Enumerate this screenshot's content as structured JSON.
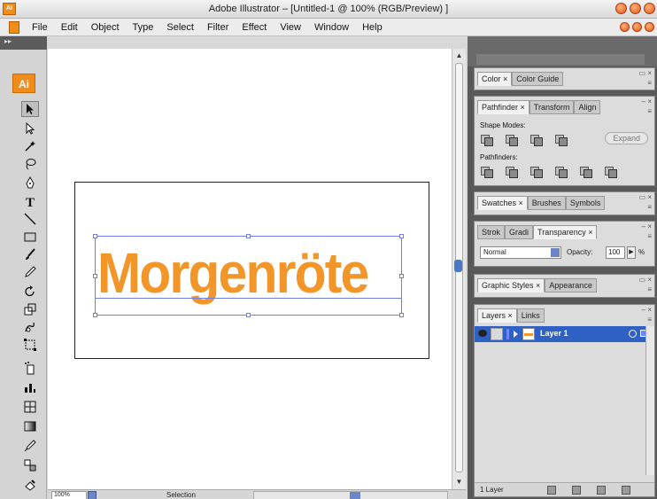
{
  "window": {
    "title": "Adobe Illustrator – [Untitled-1 @ 100% (RGB/Preview) ]",
    "app_icon_text": "AI"
  },
  "menu": {
    "items": [
      "File",
      "Edit",
      "Object",
      "Type",
      "Select",
      "Filter",
      "Effect",
      "View",
      "Window",
      "Help"
    ]
  },
  "toolbar": {
    "logo_text": "Ai",
    "grip_text": "▸▸",
    "tools": [
      "selection-tool",
      "direct-selection-tool",
      "magic-wand-tool",
      "lasso-tool",
      "pen-tool",
      "type-tool",
      "line-segment-tool",
      "rectangle-tool",
      "paintbrush-tool",
      "pencil-tool",
      "rotate-tool",
      "scale-tool",
      "warp-tool",
      "free-transform-tool",
      "symbol-sprayer-tool",
      "column-graph-tool",
      "mesh-tool",
      "gradient-tool",
      "eyedropper-tool",
      "blend-tool",
      "live-paint-tool"
    ]
  },
  "canvas": {
    "artwork_text": "Morgenröte",
    "artwork_color": "#f3962a",
    "selection_color": "#6f7fe6"
  },
  "statusbar": {
    "zoom": "100%",
    "status_text": "Selection"
  },
  "panels": {
    "color": {
      "tabs": [
        "Color ×",
        "Color Guide"
      ]
    },
    "pathfinder": {
      "tabs": [
        "Pathfinder ×",
        "Transform",
        "Align"
      ],
      "shape_modes_label": "Shape Modes:",
      "expand_label": "Expand",
      "pathfinders_label": "Pathfinders:"
    },
    "swatches": {
      "tabs": [
        "Swatches ×",
        "Brushes",
        "Symbols"
      ]
    },
    "transparency": {
      "tabs": [
        "Strok",
        "Gradi",
        "Transparency ×"
      ],
      "blend_mode": "Normal",
      "opacity_label": "Opacity:",
      "opacity_value": "100",
      "percent": "%"
    },
    "graphic_styles": {
      "tabs": [
        "Graphic Styles ×",
        "Appearance"
      ]
    },
    "layers": {
      "tabs": [
        "Layers ×",
        "Links"
      ],
      "layer_name": "Layer 1",
      "layer_color": "#2f60c4",
      "count": "1 Layer"
    }
  }
}
